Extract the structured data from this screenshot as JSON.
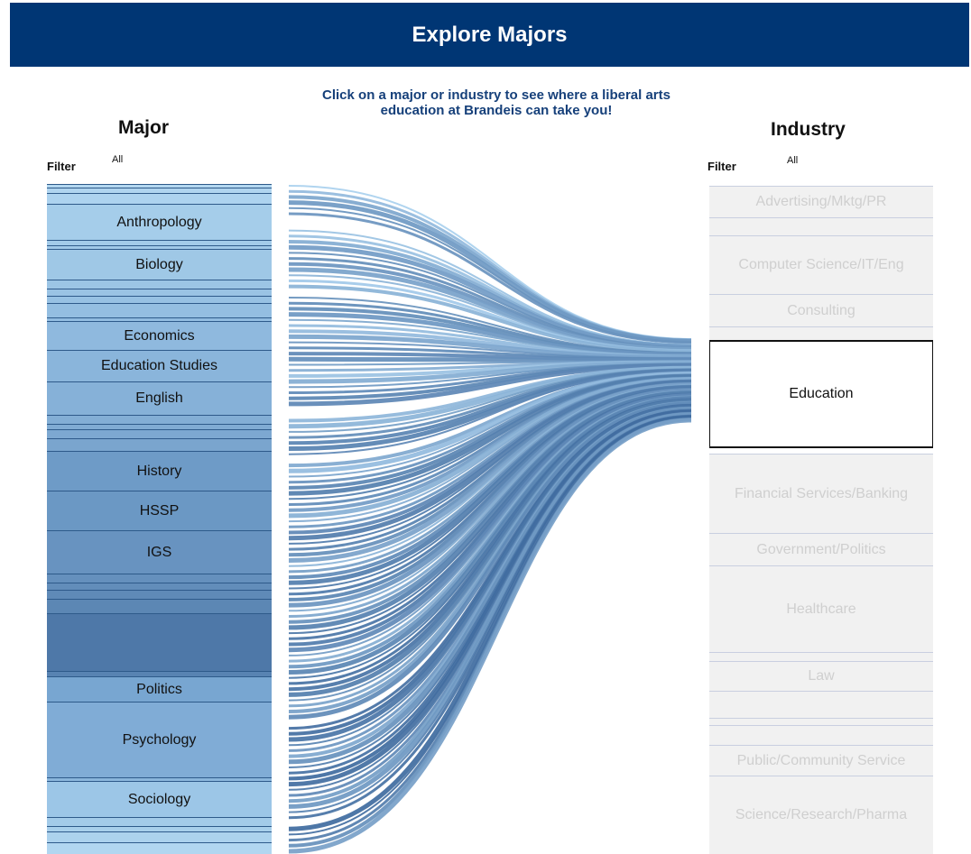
{
  "header": {
    "title": "Explore Majors"
  },
  "instruction": "Click on a major or industry to see where a liberal arts education at Brandeis can take you!",
  "majors_panel": {
    "title": "Major",
    "filter_label": "Filter",
    "filter_value": "All"
  },
  "industry_panel": {
    "title": "Industry",
    "filter_label": "Filter",
    "filter_value": "All"
  },
  "majors": [
    {
      "label": "Anthropology",
      "color": "#a5cdea"
    },
    {
      "label": "Biology",
      "color": "#9fc8e6"
    },
    {
      "label": "Economics",
      "color": "#8fb9de"
    },
    {
      "label": "Education Studies",
      "color": "#8ab5db"
    },
    {
      "label": "English",
      "color": "#86b1d8"
    },
    {
      "label": "History",
      "color": "#6e9bc7"
    },
    {
      "label": "HSSP",
      "color": "#6b98c4"
    },
    {
      "label": "IGS",
      "color": "#6893c0"
    },
    {
      "label": "Politics",
      "color": "#78a6d1"
    },
    {
      "label": "Psychology",
      "color": "#80acd6"
    },
    {
      "label": "Sociology",
      "color": "#9cc6e7"
    }
  ],
  "industries": [
    {
      "label": "Advertising/Mktg/PR",
      "selected": false
    },
    {
      "label": "Computer Science/IT/Eng",
      "selected": false
    },
    {
      "label": "Consulting",
      "selected": false
    },
    {
      "label": "Education",
      "selected": true
    },
    {
      "label": "Financial Services/Banking",
      "selected": false
    },
    {
      "label": "Government/Politics",
      "selected": false
    },
    {
      "label": "Healthcare",
      "selected": false
    },
    {
      "label": "Law",
      "selected": false
    },
    {
      "label": "Public/Community Service",
      "selected": false
    },
    {
      "label": "Science/Research/Pharma",
      "selected": false
    }
  ],
  "colors": {
    "header_bg": "#003674",
    "instruction_text": "#16407a",
    "flow_light": "#a9d0ee",
    "flow_dark": "#3f6b9f",
    "industry_inactive_bg": "#f1f1f1",
    "industry_inactive_text": "#cfcfcf"
  }
}
